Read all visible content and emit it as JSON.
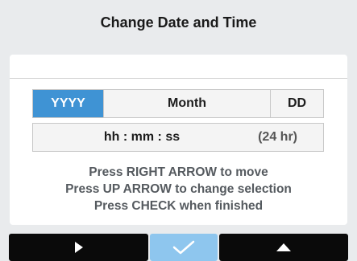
{
  "header": {
    "title": "Change Date and Time"
  },
  "date_fields": {
    "year": "YYYY",
    "month": "Month",
    "day": "DD",
    "selected": "year"
  },
  "time_field": {
    "value": "hh : mm : ss",
    "format": "(24 hr)"
  },
  "instructions": [
    "Press RIGHT ARROW to move",
    "Press UP ARROW to change selection",
    "Press CHECK when finished"
  ],
  "footer": {
    "buttons": [
      {
        "icon": "right-arrow-icon"
      },
      {
        "icon": "check-icon"
      },
      {
        "icon": "up-arrow-icon"
      }
    ]
  },
  "colors": {
    "selected_field": "#3f93d4",
    "confirm_button": "#8ec6ee",
    "nav_button": "#0a0a0a"
  }
}
